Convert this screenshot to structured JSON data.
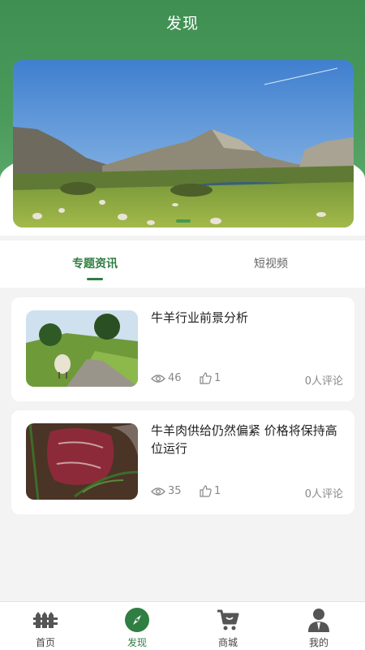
{
  "header": {
    "title": "发现"
  },
  "tabs": [
    {
      "label": "专题资讯",
      "active": true
    },
    {
      "label": "短视频",
      "active": false
    }
  ],
  "articles": [
    {
      "title": "牛羊行业前景分析",
      "views": "46",
      "likes": "1",
      "comments": "0人评论",
      "thumb": "sheep-meadow"
    },
    {
      "title": "牛羊肉供给仍然偏紧 价格将保持高位运行",
      "views": "35",
      "likes": "1",
      "comments": "0人评论",
      "thumb": "raw-beef"
    }
  ],
  "nav": [
    {
      "label": "首页",
      "icon": "fence-icon",
      "active": false
    },
    {
      "label": "发现",
      "icon": "compass-icon",
      "active": true
    },
    {
      "label": "商城",
      "icon": "cart-icon",
      "active": false
    },
    {
      "label": "我的",
      "icon": "user-icon",
      "active": false
    }
  ],
  "colors": {
    "brand": "#3f8f52",
    "accent": "#2f7e42"
  }
}
